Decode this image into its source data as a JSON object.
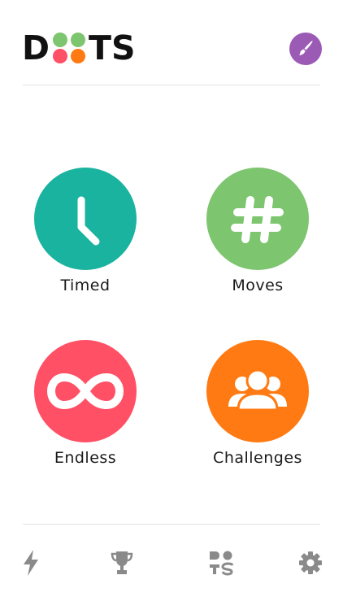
{
  "colors": {
    "teal": "#1ab39f",
    "green": "#7dc56e",
    "red": "#ff5066",
    "orange": "#ff7a12",
    "purple": "#9b5bb5",
    "icon_gray": "#8a8a8a",
    "dot_green": "#7dc56e",
    "dot_red": "#ff5066",
    "dot_orange": "#ff7a12"
  },
  "header": {
    "logo_left": "D",
    "logo_right": "TS",
    "brush_icon": "paintbrush-icon"
  },
  "modes": [
    {
      "label": "Timed",
      "icon": "clock-icon"
    },
    {
      "label": "Moves",
      "icon": "hashtag-icon"
    },
    {
      "label": "Endless",
      "icon": "infinity-icon"
    },
    {
      "label": "Challenges",
      "icon": "group-icon"
    }
  ],
  "tabbar": {
    "icons": [
      "lightning-icon",
      "trophy-icon",
      "dots-shapes-icon",
      "gear-icon"
    ]
  }
}
